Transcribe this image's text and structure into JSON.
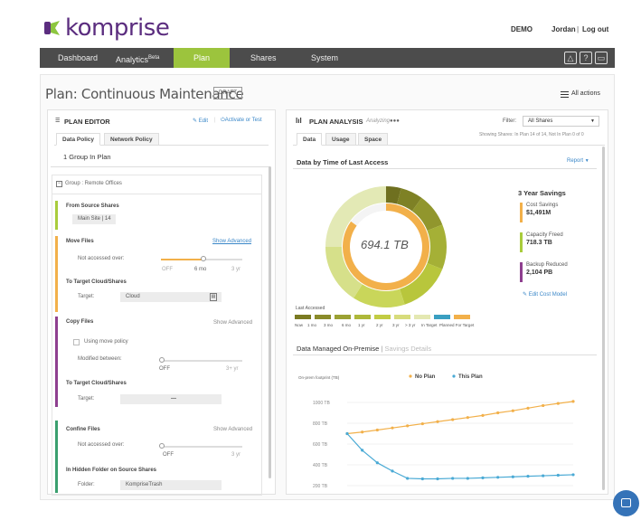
{
  "header": {
    "logo": "komprise",
    "demo": "DEMO",
    "user": "Jordan",
    "sep": "|",
    "logout": "Log out"
  },
  "nav": {
    "items": [
      "Dashboard",
      "Analytics",
      "Plan",
      "Shares",
      "System"
    ],
    "beta": "Beta"
  },
  "page": {
    "title": "Plan: Continuous Maintenance",
    "draft": "DRAFT",
    "all_actions": "All actions"
  },
  "editor": {
    "title": "PLAN EDITOR",
    "edit": "Edit",
    "activate": "Activate or Test",
    "tabs": [
      "Data Policy",
      "Network Policy"
    ],
    "groups_count": "1 Group In Plan",
    "group_label": "Group : Remote Offices",
    "from_source": "From Source Shares",
    "source_value": "Main Site | 14",
    "move_files": "Move Files",
    "show_advanced": "Show Advanced",
    "not_accessed": "Not accessed over:",
    "move_scale": [
      "OFF",
      "6 mo",
      "3 yr"
    ],
    "to_target": "To Target Cloud/Shares",
    "target_label": "Target:",
    "target_value": "Cloud",
    "copy_files": "Copy Files",
    "using_move": "Using move policy",
    "modified_between": "Modified between:",
    "copy_scale": [
      "OFF",
      "3+ yr"
    ],
    "target_value2": "—",
    "confine_files": "Confine Files",
    "confine_scale": [
      "OFF",
      "3 yr"
    ],
    "hidden_folder": "In Hidden Folder on Source Shares",
    "folder_label": "Folder:",
    "folder_value": "KompriseTrash"
  },
  "analysis": {
    "title": "PLAN ANALYSIS",
    "analyzing": "Analyzing",
    "filter_label": "Filter:",
    "filter_value": "All Shares",
    "showing": "Showing Shares: In Plan 14 of 14, Not In Plan 0 of 0",
    "tabs": [
      "Data",
      "Usage",
      "Space"
    ],
    "section1": "Data by Time of Last Access",
    "report": "Report",
    "donut_total": "694.1 TB",
    "savings_title": "3 Year Savings",
    "savings": [
      {
        "label": "Cost Savings",
        "value": "$1,491M",
        "color": "#f2b04a"
      },
      {
        "label": "Capacity Freed",
        "value": "718.3 TB",
        "color": "#a9cc3c"
      },
      {
        "label": "Backup Reduced",
        "value": "2,104 PB",
        "color": "#8e3f8f"
      }
    ],
    "edit_cost": "Edit Cost Model",
    "last_accessed": "Last Accessed",
    "legend_labels": [
      "Now",
      "1 mo",
      "3 mo",
      "6 mo",
      "1 yr",
      "2 yr",
      "3 yr",
      "> 3 yr",
      "In Target",
      "Planned For Target"
    ],
    "legend_colors": [
      "#7a7a22",
      "#8a8b2a",
      "#9ba133",
      "#aeb83a",
      "#c2cc44",
      "#d7dc7c",
      "#e4e8b2",
      "#3a9fc1",
      "#f2b04a"
    ],
    "section2": "Data Managed On-Premise",
    "section2b": "Savings Details"
  },
  "chart_data": [
    {
      "type": "pie",
      "values": [
        4,
        6,
        9,
        12,
        14,
        14,
        16,
        25
      ],
      "colors": [
        "#6f7020",
        "#7e8125",
        "#91962d",
        "#a5b036",
        "#b8c63c",
        "#c9d65a",
        "#d6e08a",
        "#e3e9b5"
      ],
      "inner_values": [
        85,
        15
      ],
      "inner_colors": [
        "#f2b04a",
        "#f4f4f4"
      ],
      "total": "694.1 TB"
    },
    {
      "type": "line",
      "ylabel": "On-prem footprint (TB)",
      "yticks": [
        "1000 TB",
        "800 TB",
        "600 TB",
        "400 TB",
        "200 TB"
      ],
      "ylim": [
        200,
        1000
      ],
      "series": [
        {
          "name": "No Plan",
          "color": "#f2b04a",
          "values": [
            700,
            715,
            735,
            755,
            775,
            795,
            815,
            835,
            855,
            875,
            900,
            920,
            945,
            970,
            990,
            1010
          ]
        },
        {
          "name": "This Plan",
          "color": "#4aaad5",
          "values": [
            700,
            540,
            420,
            340,
            270,
            265,
            265,
            270,
            270,
            275,
            280,
            285,
            290,
            295,
            300,
            305
          ]
        }
      ]
    }
  ]
}
